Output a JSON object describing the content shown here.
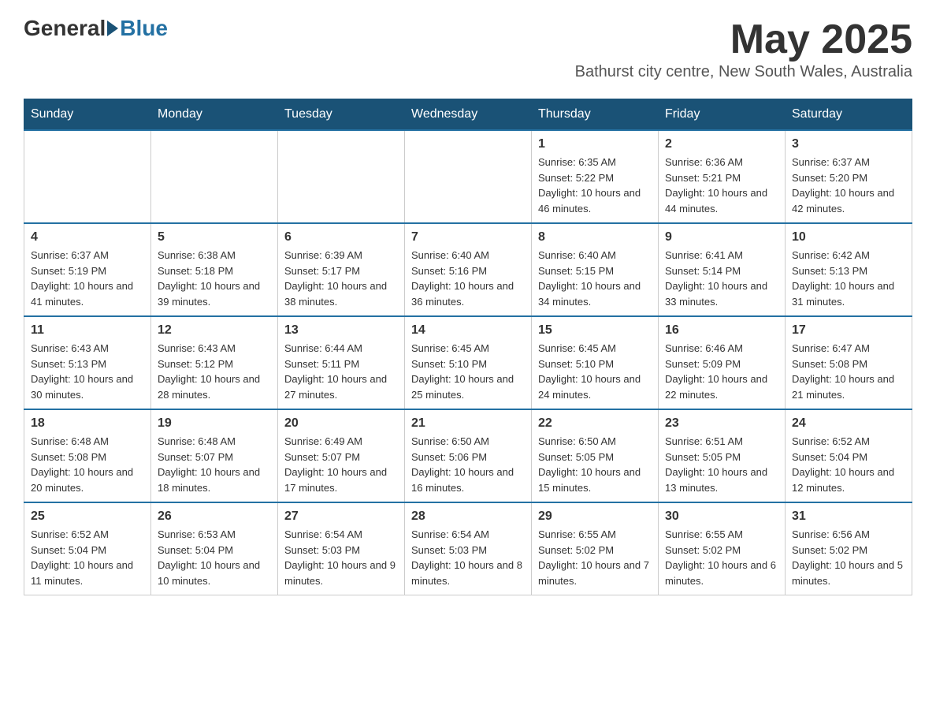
{
  "header": {
    "logo_general": "General",
    "logo_blue": "Blue",
    "month_title": "May 2025",
    "subtitle": "Bathurst city centre, New South Wales, Australia"
  },
  "weekdays": [
    "Sunday",
    "Monday",
    "Tuesday",
    "Wednesday",
    "Thursday",
    "Friday",
    "Saturday"
  ],
  "weeks": [
    [
      {
        "day": "",
        "sunrise": "",
        "sunset": "",
        "daylight": ""
      },
      {
        "day": "",
        "sunrise": "",
        "sunset": "",
        "daylight": ""
      },
      {
        "day": "",
        "sunrise": "",
        "sunset": "",
        "daylight": ""
      },
      {
        "day": "",
        "sunrise": "",
        "sunset": "",
        "daylight": ""
      },
      {
        "day": "1",
        "sunrise": "Sunrise: 6:35 AM",
        "sunset": "Sunset: 5:22 PM",
        "daylight": "Daylight: 10 hours and 46 minutes."
      },
      {
        "day": "2",
        "sunrise": "Sunrise: 6:36 AM",
        "sunset": "Sunset: 5:21 PM",
        "daylight": "Daylight: 10 hours and 44 minutes."
      },
      {
        "day": "3",
        "sunrise": "Sunrise: 6:37 AM",
        "sunset": "Sunset: 5:20 PM",
        "daylight": "Daylight: 10 hours and 42 minutes."
      }
    ],
    [
      {
        "day": "4",
        "sunrise": "Sunrise: 6:37 AM",
        "sunset": "Sunset: 5:19 PM",
        "daylight": "Daylight: 10 hours and 41 minutes."
      },
      {
        "day": "5",
        "sunrise": "Sunrise: 6:38 AM",
        "sunset": "Sunset: 5:18 PM",
        "daylight": "Daylight: 10 hours and 39 minutes."
      },
      {
        "day": "6",
        "sunrise": "Sunrise: 6:39 AM",
        "sunset": "Sunset: 5:17 PM",
        "daylight": "Daylight: 10 hours and 38 minutes."
      },
      {
        "day": "7",
        "sunrise": "Sunrise: 6:40 AM",
        "sunset": "Sunset: 5:16 PM",
        "daylight": "Daylight: 10 hours and 36 minutes."
      },
      {
        "day": "8",
        "sunrise": "Sunrise: 6:40 AM",
        "sunset": "Sunset: 5:15 PM",
        "daylight": "Daylight: 10 hours and 34 minutes."
      },
      {
        "day": "9",
        "sunrise": "Sunrise: 6:41 AM",
        "sunset": "Sunset: 5:14 PM",
        "daylight": "Daylight: 10 hours and 33 minutes."
      },
      {
        "day": "10",
        "sunrise": "Sunrise: 6:42 AM",
        "sunset": "Sunset: 5:13 PM",
        "daylight": "Daylight: 10 hours and 31 minutes."
      }
    ],
    [
      {
        "day": "11",
        "sunrise": "Sunrise: 6:43 AM",
        "sunset": "Sunset: 5:13 PM",
        "daylight": "Daylight: 10 hours and 30 minutes."
      },
      {
        "day": "12",
        "sunrise": "Sunrise: 6:43 AM",
        "sunset": "Sunset: 5:12 PM",
        "daylight": "Daylight: 10 hours and 28 minutes."
      },
      {
        "day": "13",
        "sunrise": "Sunrise: 6:44 AM",
        "sunset": "Sunset: 5:11 PM",
        "daylight": "Daylight: 10 hours and 27 minutes."
      },
      {
        "day": "14",
        "sunrise": "Sunrise: 6:45 AM",
        "sunset": "Sunset: 5:10 PM",
        "daylight": "Daylight: 10 hours and 25 minutes."
      },
      {
        "day": "15",
        "sunrise": "Sunrise: 6:45 AM",
        "sunset": "Sunset: 5:10 PM",
        "daylight": "Daylight: 10 hours and 24 minutes."
      },
      {
        "day": "16",
        "sunrise": "Sunrise: 6:46 AM",
        "sunset": "Sunset: 5:09 PM",
        "daylight": "Daylight: 10 hours and 22 minutes."
      },
      {
        "day": "17",
        "sunrise": "Sunrise: 6:47 AM",
        "sunset": "Sunset: 5:08 PM",
        "daylight": "Daylight: 10 hours and 21 minutes."
      }
    ],
    [
      {
        "day": "18",
        "sunrise": "Sunrise: 6:48 AM",
        "sunset": "Sunset: 5:08 PM",
        "daylight": "Daylight: 10 hours and 20 minutes."
      },
      {
        "day": "19",
        "sunrise": "Sunrise: 6:48 AM",
        "sunset": "Sunset: 5:07 PM",
        "daylight": "Daylight: 10 hours and 18 minutes."
      },
      {
        "day": "20",
        "sunrise": "Sunrise: 6:49 AM",
        "sunset": "Sunset: 5:07 PM",
        "daylight": "Daylight: 10 hours and 17 minutes."
      },
      {
        "day": "21",
        "sunrise": "Sunrise: 6:50 AM",
        "sunset": "Sunset: 5:06 PM",
        "daylight": "Daylight: 10 hours and 16 minutes."
      },
      {
        "day": "22",
        "sunrise": "Sunrise: 6:50 AM",
        "sunset": "Sunset: 5:05 PM",
        "daylight": "Daylight: 10 hours and 15 minutes."
      },
      {
        "day": "23",
        "sunrise": "Sunrise: 6:51 AM",
        "sunset": "Sunset: 5:05 PM",
        "daylight": "Daylight: 10 hours and 13 minutes."
      },
      {
        "day": "24",
        "sunrise": "Sunrise: 6:52 AM",
        "sunset": "Sunset: 5:04 PM",
        "daylight": "Daylight: 10 hours and 12 minutes."
      }
    ],
    [
      {
        "day": "25",
        "sunrise": "Sunrise: 6:52 AM",
        "sunset": "Sunset: 5:04 PM",
        "daylight": "Daylight: 10 hours and 11 minutes."
      },
      {
        "day": "26",
        "sunrise": "Sunrise: 6:53 AM",
        "sunset": "Sunset: 5:04 PM",
        "daylight": "Daylight: 10 hours and 10 minutes."
      },
      {
        "day": "27",
        "sunrise": "Sunrise: 6:54 AM",
        "sunset": "Sunset: 5:03 PM",
        "daylight": "Daylight: 10 hours and 9 minutes."
      },
      {
        "day": "28",
        "sunrise": "Sunrise: 6:54 AM",
        "sunset": "Sunset: 5:03 PM",
        "daylight": "Daylight: 10 hours and 8 minutes."
      },
      {
        "day": "29",
        "sunrise": "Sunrise: 6:55 AM",
        "sunset": "Sunset: 5:02 PM",
        "daylight": "Daylight: 10 hours and 7 minutes."
      },
      {
        "day": "30",
        "sunrise": "Sunrise: 6:55 AM",
        "sunset": "Sunset: 5:02 PM",
        "daylight": "Daylight: 10 hours and 6 minutes."
      },
      {
        "day": "31",
        "sunrise": "Sunrise: 6:56 AM",
        "sunset": "Sunset: 5:02 PM",
        "daylight": "Daylight: 10 hours and 5 minutes."
      }
    ]
  ]
}
